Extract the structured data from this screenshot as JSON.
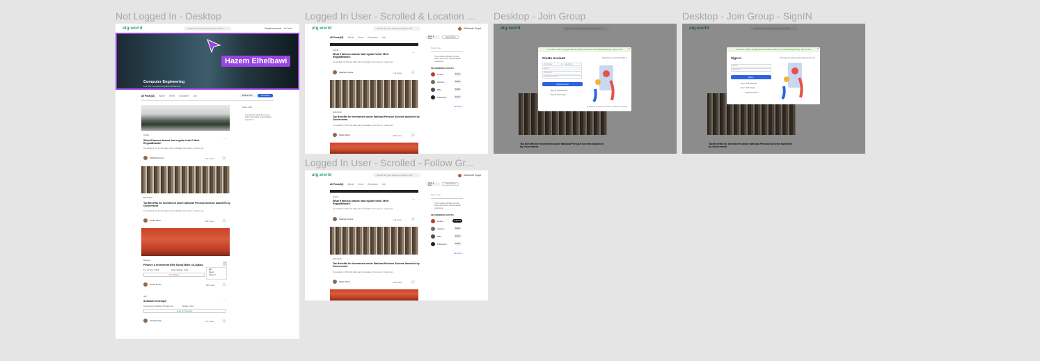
{
  "frames": {
    "f1": {
      "label": "Not Logged In - Desktop"
    },
    "f2": {
      "label": "Logged In User - Scrolled & Location ..."
    },
    "f3": {
      "label": "Desktop - Join Group"
    },
    "f4": {
      "label": "Desktop - Join Group - SignIN"
    },
    "f5": {
      "label": "Logged In User - Scrolled - Follow Gr..."
    }
  },
  "nav": {
    "logo": "atg.world",
    "search_placeholder": "Search for your favorite groups in ATG",
    "create_account": "Create account.",
    "signin": "It's free!",
    "user_name": "Siddharth Goyal"
  },
  "hero": {
    "title": "Computer Engineering",
    "subtitle": "142,765 Computer Engineers follow this"
  },
  "cursor": {
    "name": "Hazem Elhelbawi"
  },
  "tabs": [
    "All Posts(32)",
    "Article",
    "Event",
    "Education",
    "Job"
  ],
  "actions": {
    "write_post": "Write a Post",
    "join_group": "Join Group",
    "leave_group": "Leave Group"
  },
  "location": {
    "placeholder": "Noida, India",
    "note": "Your location will help us serve better and extend a personalised experience."
  },
  "posts": {
    "p1": {
      "category": "Article",
      "title": "What if famous brands had regular fonts? Meet RegulaBrands!",
      "body": "I've worked in UX for the better part of a decade. From now on, I plan to rel...",
      "author": "Sarthak Kamra",
      "views": "1.4k views"
    },
    "p2": {
      "category": "Education",
      "title": "Tax Benefits for Investment under National Pension Scheme launched by Government",
      "body": "I've worked in UX for the better part of a decade. From now on, I plan to rel...",
      "author": "Sarah West",
      "views": "4.8k views"
    },
    "p3": {
      "category": "Meetup",
      "title": "Finance & Investment Elite Social Mixer @Lujiazui",
      "date": "Fri, 12 Oct, 2018",
      "place": "Ahmedabad, India",
      "visit": "Visit Website",
      "author": "Ronal Jones",
      "views": "800 views"
    },
    "p4": {
      "category": "Job",
      "title": "Software Developer",
      "company": "Innovaccer Analytics Private Ltd.",
      "place": "Noida, India",
      "apply": "Apply on Timesjobs",
      "author": "Joseph Gray",
      "views": "1.7k views"
    }
  },
  "menu": [
    "Edit",
    "Report",
    "Option 3"
  ],
  "groups": {
    "header": "RECOMMENDED GROUPS",
    "items": [
      {
        "name": "Leisure",
        "color": "#c0392b"
      },
      {
        "name": "Activism",
        "color": "#7d6a52"
      },
      {
        "name": "MBA",
        "color": "#4b4b4b"
      },
      {
        "name": "Philosophy",
        "color": "#222222"
      }
    ],
    "follow": "Follow",
    "followed": "Followed",
    "see_more": "See More..."
  },
  "modal": {
    "banner": "Let's learn, share & engage with each other's passion for Computer Engineering. Sign up now",
    "create_title": "Create Account",
    "have_account": "Already have an account? Sign In",
    "first_name": "First Name",
    "last_name": "Last Name",
    "email": "Email",
    "password": "Password",
    "confirm": "Confirm Password",
    "create_btn": "Create Account",
    "fb": "Sign up with Facebook",
    "google": "Sign up with Google",
    "terms": "By signing up, you agree to our Terms & conditions, Privacy policy",
    "signin_title": "Sign In",
    "no_account": "Don't have an account yet? Create new for free!",
    "signin_btn": "Sign In",
    "fb_in": "Sign in with Facebook",
    "google_in": "Sign in with Google",
    "forgot": "Forgot Password?"
  },
  "colors": {
    "accent": "#9a45e0",
    "brand": "#34a08e",
    "blue": "#2d63e0"
  }
}
